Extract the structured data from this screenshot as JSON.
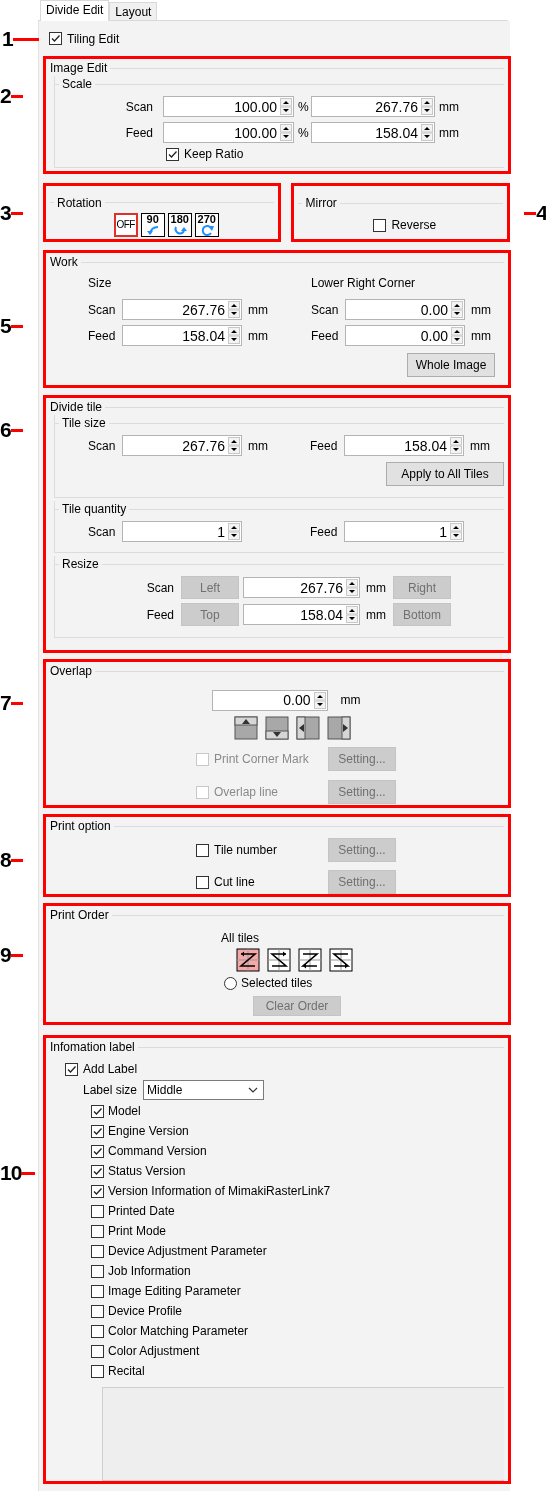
{
  "tabs": [
    {
      "label": "Divide Edit",
      "selected": true
    },
    {
      "label": "Layout",
      "selected": false
    }
  ],
  "tiling_edit": {
    "callout": "1",
    "label": "Tiling Edit",
    "checked": true
  },
  "image_edit": {
    "callout": "2",
    "title": "Image Edit",
    "scale": {
      "title": "Scale",
      "rows": [
        {
          "label": "Scan",
          "percent": "100.00",
          "percent_unit": "%",
          "length": "267.76",
          "length_unit": "mm"
        },
        {
          "label": "Feed",
          "percent": "100.00",
          "percent_unit": "%",
          "length": "158.04",
          "length_unit": "mm"
        }
      ],
      "keep_ratio": {
        "label": "Keep Ratio",
        "checked": true
      }
    }
  },
  "rotation": {
    "callout": "3",
    "title": "Rotation",
    "options": [
      {
        "label": "OFF",
        "kind": "text",
        "selected": true
      },
      {
        "label": "90",
        "kind": "quarter",
        "selected": false
      },
      {
        "label": "180",
        "kind": "half",
        "selected": false
      },
      {
        "label": "270",
        "kind": "full",
        "selected": false
      }
    ]
  },
  "mirror": {
    "callout": "4",
    "title": "Mirror",
    "reverse": {
      "label": "Reverse",
      "checked": false
    }
  },
  "work": {
    "callout": "5",
    "title": "Work",
    "blocks": [
      {
        "title": "Size",
        "rows": [
          {
            "label": "Scan",
            "value": "267.76",
            "unit": "mm"
          },
          {
            "label": "Feed",
            "value": "158.04",
            "unit": "mm"
          }
        ]
      },
      {
        "title": "Lower Right Corner",
        "rows": [
          {
            "label": "Scan",
            "value": "0.00",
            "unit": "mm"
          },
          {
            "label": "Feed",
            "value": "0.00",
            "unit": "mm"
          }
        ]
      }
    ],
    "button": {
      "label": "Whole Image",
      "disabled": false
    }
  },
  "divide_tile": {
    "callout": "6",
    "title": "Divide tile",
    "tile_size": {
      "title": "Tile size",
      "fields": [
        {
          "label": "Scan",
          "value": "267.76",
          "unit": "mm"
        },
        {
          "label": "Feed",
          "value": "158.04",
          "unit": "mm"
        }
      ],
      "button": {
        "label": "Apply to All Tiles",
        "disabled": false
      }
    },
    "tile_quantity": {
      "title": "Tile quantity",
      "fields": [
        {
          "label": "Scan",
          "value": "1"
        },
        {
          "label": "Feed",
          "value": "1"
        }
      ]
    },
    "resize": {
      "title": "Resize",
      "rows": [
        {
          "label": "Scan",
          "before": {
            "label": "Left",
            "disabled": true
          },
          "value": "267.76",
          "unit": "mm",
          "after": {
            "label": "Right",
            "disabled": true
          }
        },
        {
          "label": "Feed",
          "before": {
            "label": "Top",
            "disabled": true
          },
          "value": "158.04",
          "unit": "mm",
          "after": {
            "label": "Bottom",
            "disabled": true
          }
        }
      ]
    }
  },
  "overlap": {
    "callout": "7",
    "title": "Overlap",
    "value": "0.00",
    "unit": "mm",
    "options": [
      {
        "label": "Print Corner Mark",
        "checked": false,
        "disabled": true,
        "button": {
          "label": "Setting...",
          "disabled": true
        }
      },
      {
        "label": "Overlap line",
        "checked": false,
        "disabled": true,
        "button": {
          "label": "Setting...",
          "disabled": true
        }
      }
    ]
  },
  "print_option": {
    "callout": "8",
    "title": "Print option",
    "options": [
      {
        "label": "Tile number",
        "checked": false,
        "disabled": false,
        "button": {
          "label": "Setting...",
          "disabled": true
        }
      },
      {
        "label": "Cut line",
        "checked": false,
        "disabled": false,
        "button": {
          "label": "Setting...",
          "disabled": true
        }
      }
    ]
  },
  "print_order": {
    "callout": "9",
    "title": "Print Order",
    "all_tiles": "All tiles",
    "orders": [
      {
        "selected": true
      },
      {
        "selected": false
      },
      {
        "selected": false
      },
      {
        "selected": false
      }
    ],
    "selected_tiles": {
      "label": "Selected tiles",
      "selected": false
    },
    "button": {
      "label": "Clear Order",
      "disabled": true
    }
  },
  "information_label": {
    "callout": "10",
    "title": "Infomation label",
    "add_label": {
      "label": "Add Label",
      "checked": true
    },
    "label_size": {
      "label": "Label size",
      "value": "Middle"
    },
    "items": [
      {
        "label": "Model",
        "checked": true
      },
      {
        "label": "Engine Version",
        "checked": true
      },
      {
        "label": "Command Version",
        "checked": true
      },
      {
        "label": "Status Version",
        "checked": true
      },
      {
        "label": "Version Information of MimakiRasterLink7",
        "checked": true
      },
      {
        "label": "Printed Date",
        "checked": false
      },
      {
        "label": "Print Mode",
        "checked": false
      },
      {
        "label": "Device Adjustment Parameter",
        "checked": false
      },
      {
        "label": "Job Information",
        "checked": false
      },
      {
        "label": "Image Editing Parameter",
        "checked": false
      },
      {
        "label": "Device Profile",
        "checked": false
      },
      {
        "label": "Color Matching Parameter",
        "checked": false
      },
      {
        "label": "Color Adjustment",
        "checked": false
      },
      {
        "label": "Recital",
        "checked": false
      }
    ]
  }
}
